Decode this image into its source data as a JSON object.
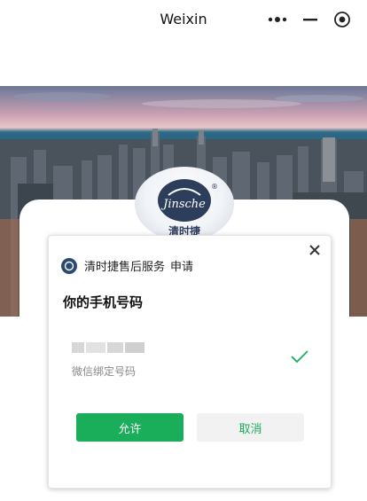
{
  "window": {
    "title": "Weixin"
  },
  "titlebar": {
    "icons": [
      "more-icon",
      "minimize-icon",
      "close-circle-icon"
    ]
  },
  "logo": {
    "brand_latin": "Jinsche",
    "brand_cn": "清时捷",
    "registered": "®"
  },
  "dialog": {
    "app_name": "清时捷售后服务",
    "action": "申请",
    "heading": "你的手机号码",
    "phone_desc": "微信绑定号码",
    "allow_label": "允许",
    "cancel_label": "取消"
  },
  "colors": {
    "accent": "#1aad5a",
    "dialog_bg": "#ffffff",
    "cancel_bg": "#f2f2f2"
  }
}
